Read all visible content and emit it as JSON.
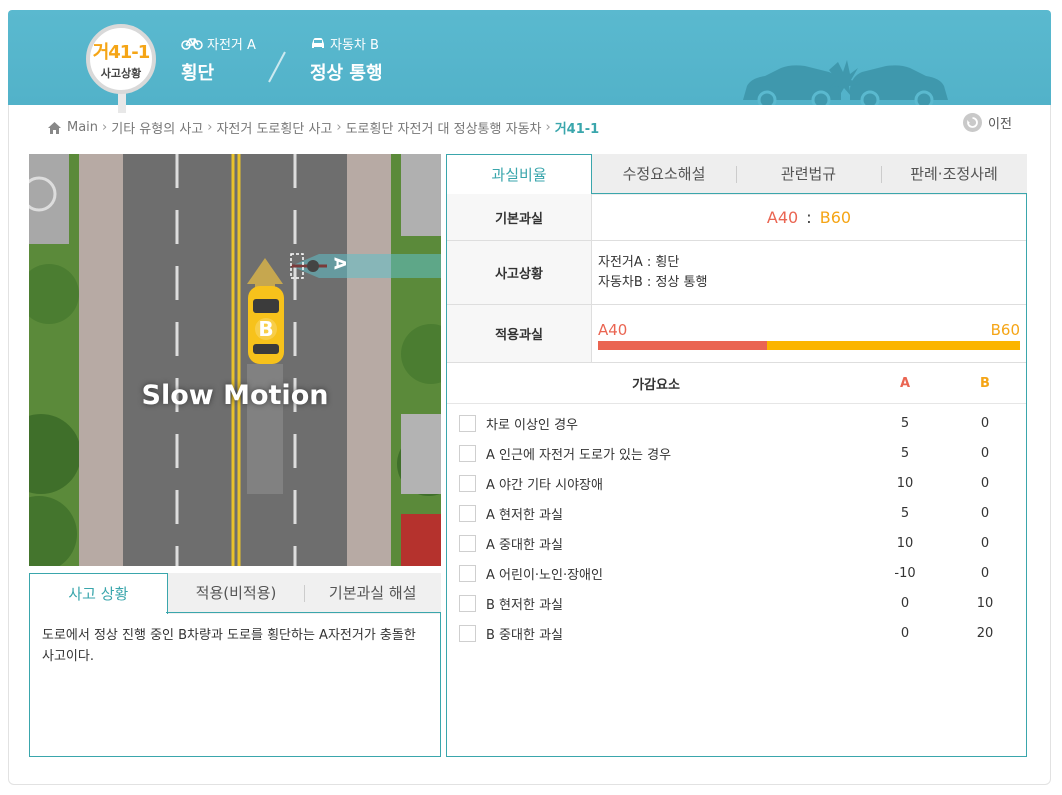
{
  "header": {
    "case_code": "거41-1",
    "case_sub": "사고상황",
    "party_a": {
      "role": "자전거 A",
      "action": "횡단"
    },
    "party_b": {
      "role": "자동차 B",
      "action": "정상 통행"
    }
  },
  "breadcrumb": [
    "Main",
    "기타 유형의 사고",
    "자전거 도로횡단 사고",
    "도로횡단 자전거 대 정상통행 자동차",
    "거41-1"
  ],
  "back_label": "이전",
  "scene": {
    "caption": "Slow Motion",
    "vehicle_a_label": "A",
    "vehicle_b_label": "B"
  },
  "left_tabs": [
    "사고 상황",
    "적용(비적용)",
    "기본과실 해설"
  ],
  "left_panel_text": "도로에서 정상 진행 중인 B차량과 도로를 횡단하는 A자전거가 충돌한 사고이다.",
  "right_tabs": [
    "과실비율",
    "수정요소해설",
    "관련법규",
    "판례·조정사례"
  ],
  "fault": {
    "basic_label": "기본과실",
    "basic_a": "A40",
    "basic_sep": ":",
    "basic_b": "B60",
    "situation_label": "사고상황",
    "situation_lines": [
      "자전거A : 횡단",
      "자동차B : 정상 통행"
    ],
    "applied_label": "적용과실",
    "applied_a": "A40",
    "applied_b": "B60",
    "applied_a_ratio": 0.4,
    "color_a": "#ea6552",
    "color_b": "#fbb500"
  },
  "factors": {
    "header": {
      "name": "가감요소",
      "a": "A",
      "b": "B"
    },
    "rows": [
      {
        "name": "차로 이상인 경우",
        "a": "5",
        "b": "0"
      },
      {
        "name": "A 인근에 자전거 도로가 있는 경우",
        "a": "5",
        "b": "0"
      },
      {
        "name": "A 야간 기타 시야장애",
        "a": "10",
        "b": "0"
      },
      {
        "name": "A 현저한 과실",
        "a": "5",
        "b": "0"
      },
      {
        "name": "A 중대한 과실",
        "a": "10",
        "b": "0"
      },
      {
        "name": "A 어린이·노인·장애인",
        "a": "-10",
        "b": "0"
      },
      {
        "name": "B 현저한 과실",
        "a": "0",
        "b": "10"
      },
      {
        "name": "B 중대한 과실",
        "a": "0",
        "b": "20"
      }
    ]
  }
}
